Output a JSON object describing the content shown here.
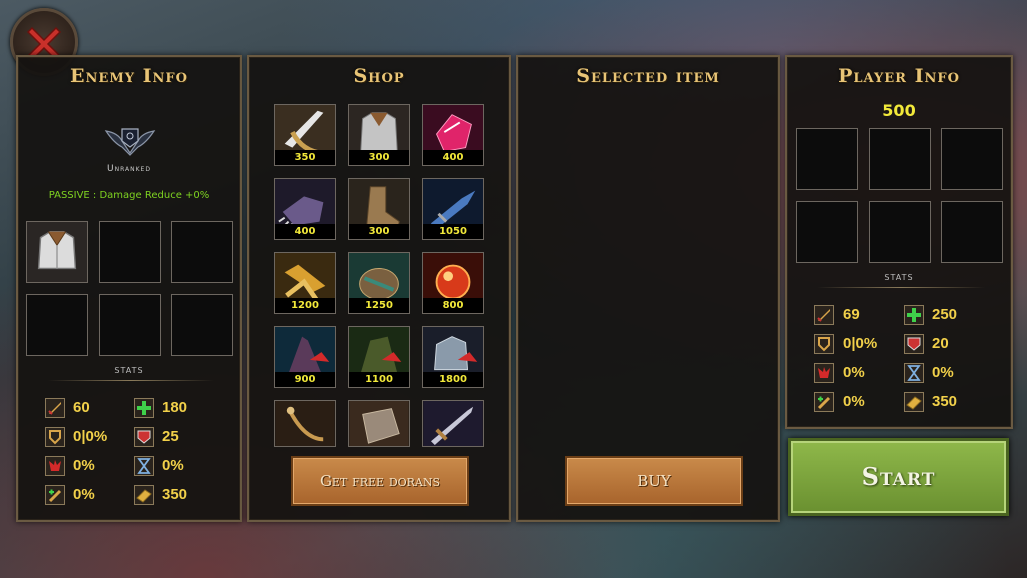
{
  "close_button": {
    "icon": "close-icon"
  },
  "enemy": {
    "title": "Enemy Info",
    "rank_label": "Unranked",
    "passive": "PASSIVE : Damage Reduce +0%",
    "stats_label": "STATS",
    "stats": {
      "attack": "60",
      "health": "180",
      "armor_pen": "0|0%",
      "armor": "25",
      "crit": "0%",
      "cooldown": "0%",
      "lifesteal": "0%",
      "gold": "350"
    }
  },
  "shop": {
    "title": "Shop",
    "items": [
      {
        "price": "350"
      },
      {
        "price": "300"
      },
      {
        "price": "400"
      },
      {
        "price": "400"
      },
      {
        "price": "300"
      },
      {
        "price": "1050"
      },
      {
        "price": "1200"
      },
      {
        "price": "1250"
      },
      {
        "price": "800"
      },
      {
        "price": "900"
      },
      {
        "price": "1100"
      },
      {
        "price": "1800"
      },
      {
        "price": ""
      },
      {
        "price": ""
      },
      {
        "price": ""
      }
    ],
    "free_button": "Get free dorans"
  },
  "selected": {
    "title": "Selected item",
    "buy_button": "BUY"
  },
  "player": {
    "title": "Player Info",
    "gold": "500",
    "stats_label": "STATS",
    "stats": {
      "attack": "69",
      "health": "250",
      "armor_pen": "0|0%",
      "armor": "20",
      "crit": "0%",
      "cooldown": "0%",
      "lifesteal": "0%",
      "gold": "350"
    }
  },
  "start_button": "Start",
  "colors": {
    "gold_text": "#f2e93a",
    "title": "#e8c476",
    "start_green": "#7ea43a"
  }
}
